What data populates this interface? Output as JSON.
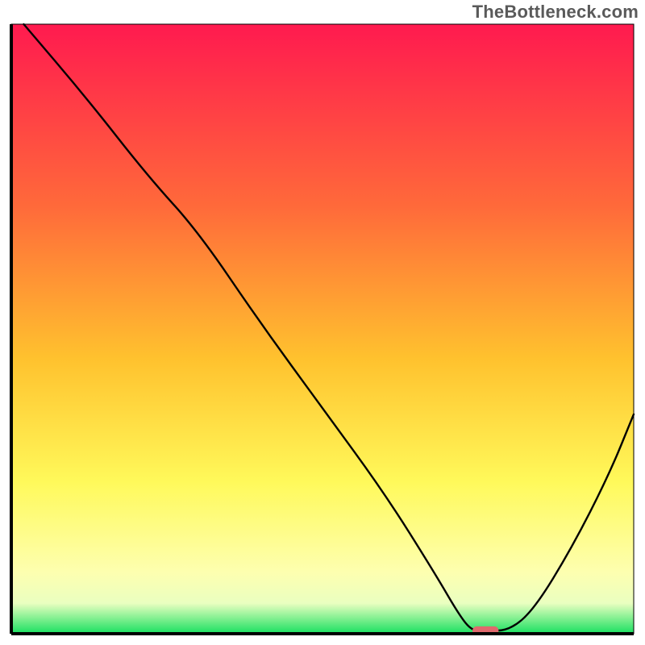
{
  "watermark": "TheBottleneck.com",
  "chart_data": {
    "type": "line",
    "title": "",
    "xlabel": "",
    "ylabel": "",
    "xlim": [
      0,
      100
    ],
    "ylim": [
      0,
      100
    ],
    "grid": false,
    "legend": false,
    "gradient_stops": [
      {
        "offset": 0,
        "color": "#ff1a4f"
      },
      {
        "offset": 30,
        "color": "#ff6a3a"
      },
      {
        "offset": 55,
        "color": "#ffc22e"
      },
      {
        "offset": 75,
        "color": "#fff95a"
      },
      {
        "offset": 90,
        "color": "#fdffb0"
      },
      {
        "offset": 95,
        "color": "#eaffc0"
      },
      {
        "offset": 100,
        "color": "#18e060"
      }
    ],
    "series": [
      {
        "name": "bottleneck-curve",
        "color": "#000000",
        "x": [
          2,
          12,
          22,
          30,
          40,
          50,
          60,
          68,
          72,
          74,
          76,
          80,
          84,
          90,
          96,
          100
        ],
        "y": [
          100,
          88,
          75,
          66,
          51,
          37,
          23,
          10,
          3,
          0.5,
          0.5,
          0.5,
          4,
          14,
          26,
          36
        ]
      }
    ],
    "marker": {
      "name": "sweet-spot",
      "color": "#e0696d",
      "x": 76.2,
      "y": 0.5,
      "width": 4.2,
      "height": 1.4
    },
    "axes": {
      "frame_color": "#000000",
      "frame_width": 4
    }
  }
}
